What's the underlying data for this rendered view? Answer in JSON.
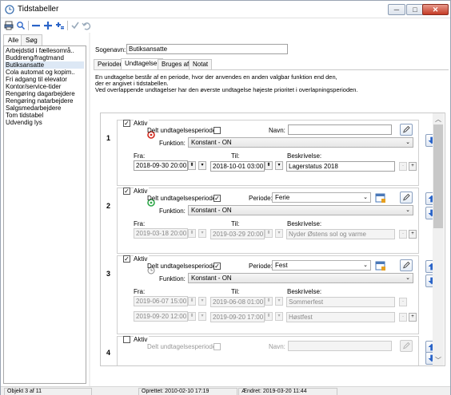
{
  "window": {
    "title": "Tidstabeller"
  },
  "left": {
    "tabs": [
      "Alle",
      "Søg"
    ],
    "items": [
      "Arbejdstid i fællesområ..",
      "Buddreng/fragtmand",
      "Butiksansatte",
      "Cola automat og kopim..",
      "Fri adgang til elevator",
      "Kontor/service-tider",
      "Rengøring dagarbejdere",
      "Rengøring natarbejdere",
      "Salgsmedarbejdere",
      "Tom tidstabel",
      "Udvendig lys"
    ],
    "selected_index": 2
  },
  "right": {
    "name_label": "Sogenavn:",
    "name_value": "Butiksansatte",
    "tabs": [
      "Perioder",
      "Undtagelser",
      "Bruges af",
      "Notat"
    ],
    "active_tab": "Undtagelser",
    "description": [
      "En undtagelse består af en periode, hvor der anvendes en anden valgbar funktion end den,",
      "der er angivet i tidstabellen.",
      "Ved overlappende undtagelser har den øverste undtagelse højeste prioritet i overlapningsperioden."
    ]
  },
  "labels": {
    "aktiv": "Aktiv",
    "delt": "Delt undtagelsesperiode",
    "navn": "Navn:",
    "periode": "Periode:",
    "funktion": "Funktion:",
    "fra": "Fra:",
    "til": "Til:",
    "beskrivelse": "Beskrivelse:"
  },
  "exceptions": [
    {
      "number": "1",
      "active": true,
      "shared": false,
      "status": "red",
      "name": "",
      "function": "Konstant - ON",
      "rows": [
        {
          "from": "2018-09-30  20:00",
          "to": "2018-10-01  03:00",
          "desc": "Lagerstatus 2018"
        }
      ]
    },
    {
      "number": "2",
      "active": true,
      "shared": true,
      "status": "green",
      "period": "Ferie",
      "function": "Konstant - ON",
      "rows": [
        {
          "from": "2019-03-18  20:00",
          "to": "2019-03-29  20:00",
          "desc": "Nyder Østens sol og varme"
        }
      ]
    },
    {
      "number": "3",
      "active": true,
      "shared": true,
      "status": "grey",
      "period": "Fest",
      "function": "Konstant - ON",
      "rows": [
        {
          "from": "2019-06-07  15:00",
          "to": "2019-06-08  01:00",
          "desc": "Sommerfest"
        },
        {
          "from": "2019-09-20  12:00",
          "to": "2019-09-20  17:00",
          "desc": "Høstfest"
        }
      ]
    },
    {
      "number": "4",
      "active": false,
      "shared": false,
      "name": ""
    }
  ],
  "status": {
    "object": "Objekt 3 af 11",
    "created": "Oprettet: 2010-02-10  17:19",
    "changed": "Ændret: 2019-03-20  11:44"
  },
  "colors": {
    "status_red": "#d42a1e",
    "status_green": "#2fa84a",
    "status_grey": "#888888",
    "arrow_blue": "#2a64c8"
  }
}
